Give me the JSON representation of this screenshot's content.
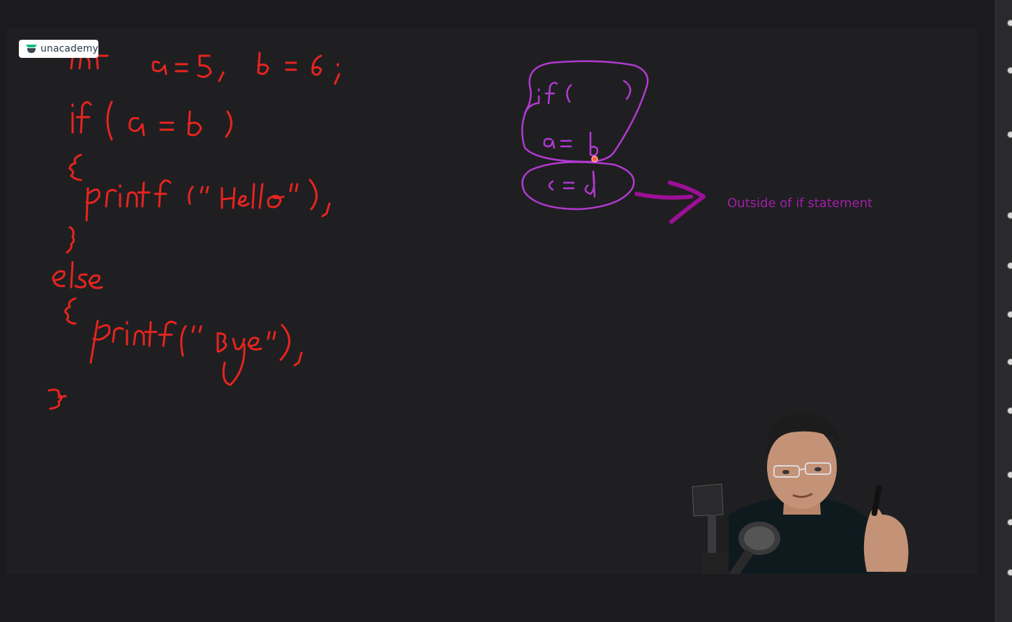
{
  "brand": {
    "logo_text": "unacademy",
    "logo_color": "#08bd80"
  },
  "whiteboard": {
    "background": "#1f1f21",
    "code_color": "#e8241f",
    "diagram_color": "#b23ad1",
    "arrow_color": "#9c0f96",
    "code_lines": [
      "int  a = 5,  b = 6 ;",
      "if ( a = b )",
      "{",
      "printf (\" Hello \"),",
      "}",
      "else",
      "{",
      "printf (\" Bye \"),",
      "}"
    ],
    "diagram": {
      "labels": [
        "if (    )",
        "a = b",
        "c = d"
      ]
    },
    "annotation": "Outside of if statement"
  },
  "presenter": {
    "icon": "webcam-video"
  }
}
